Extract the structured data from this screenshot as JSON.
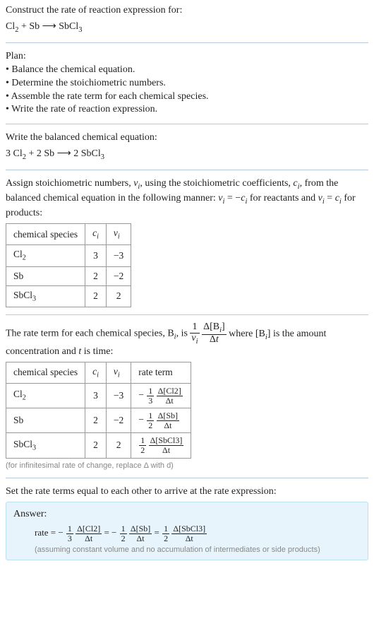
{
  "intro": {
    "prompt": "Construct the rate of reaction expression for:",
    "equation_html": "Cl<span class=\"sub\">2</span> + Sb <span class=\"arrow\">⟶</span> SbCl<span class=\"sub\">3</span>"
  },
  "plan": {
    "label": "Plan:",
    "items": [
      "Balance the chemical equation.",
      "Determine the stoichiometric numbers.",
      "Assemble the rate term for each chemical species.",
      "Write the rate of reaction expression."
    ]
  },
  "balanced": {
    "label": "Write the balanced chemical equation:",
    "equation_html": "3 Cl<span class=\"sub\">2</span> + 2 Sb <span class=\"arrow\">⟶</span> 2 SbCl<span class=\"sub\">3</span>"
  },
  "stoich_intro_html": "Assign stoichiometric numbers, <span class=\"italic\">ν<span class=\"sub\">i</span></span>, using the stoichiometric coefficients, <span class=\"italic\">c<span class=\"sub\">i</span></span>, from the balanced chemical equation in the following manner: <span class=\"italic\">ν<span class=\"sub\">i</span></span> = −<span class=\"italic\">c<span class=\"sub\">i</span></span> for reactants and <span class=\"italic\">ν<span class=\"sub\">i</span></span> = <span class=\"italic\">c<span class=\"sub\">i</span></span> for products:",
  "table1": {
    "headers": {
      "species": "chemical species",
      "c": "c",
      "nu": "ν"
    },
    "rows": [
      {
        "species_html": "Cl<span class=\"sub\">2</span>",
        "c": "3",
        "nu": "−3"
      },
      {
        "species_html": "Sb",
        "c": "2",
        "nu": "−2"
      },
      {
        "species_html": "SbCl<span class=\"sub\">3</span>",
        "c": "2",
        "nu": "2"
      }
    ]
  },
  "rateterm_intro_pre": "The rate term for each chemical species, B",
  "rateterm_intro_mid": ", is ",
  "rateterm_intro_post_html": " where [B<span class=\"sub italic\">i</span>] is the amount concentration and <span class=\"italic\">t</span> is time:",
  "table2": {
    "headers": {
      "species": "chemical species",
      "c": "c",
      "nu": "ν",
      "rate": "rate term"
    },
    "rows": [
      {
        "species_html": "Cl<span class=\"sub\">2</span>",
        "c": "3",
        "nu": "−3",
        "sign": "−",
        "coef_num": "1",
        "coef_den": "3",
        "dnum": "Δ[Cl2]",
        "dden": "Δt"
      },
      {
        "species_html": "Sb",
        "c": "2",
        "nu": "−2",
        "sign": "−",
        "coef_num": "1",
        "coef_den": "2",
        "dnum": "Δ[Sb]",
        "dden": "Δt"
      },
      {
        "species_html": "SbCl<span class=\"sub\">3</span>",
        "c": "2",
        "nu": "2",
        "sign": "",
        "coef_num": "1",
        "coef_den": "2",
        "dnum": "Δ[SbCl3]",
        "dden": "Δt"
      }
    ]
  },
  "infinitesimal_note": "(for infinitesimal rate of change, replace Δ with d)",
  "set_equal": "Set the rate terms equal to each other to arrive at the rate expression:",
  "answer": {
    "label": "Answer:",
    "prefix": "rate = ",
    "terms": [
      {
        "sign": "−",
        "coef_num": "1",
        "coef_den": "3",
        "dnum": "Δ[Cl2]",
        "dden": "Δt"
      },
      {
        "sign": "−",
        "coef_num": "1",
        "coef_den": "2",
        "dnum": "Δ[Sb]",
        "dden": "Δt"
      },
      {
        "sign": "",
        "coef_num": "1",
        "coef_den": "2",
        "dnum": "Δ[SbCl3]",
        "dden": "Δt"
      }
    ],
    "assumption": "(assuming constant volume and no accumulation of intermediates or side products)"
  }
}
